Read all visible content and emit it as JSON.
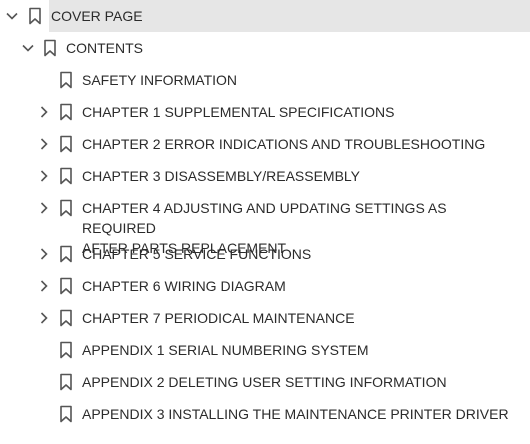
{
  "bookmarks": {
    "cover": {
      "label": "COVER PAGE",
      "expanded": true,
      "selected": true
    },
    "contents": {
      "label": "CONTENTS",
      "expanded": true
    },
    "items": [
      {
        "label": "SAFETY INFORMATION",
        "expandable": false
      },
      {
        "label": "CHAPTER 1 SUPPLEMENTAL SPECIFICATIONS",
        "expandable": true
      },
      {
        "label": "CHAPTER 2 ERROR INDICATIONS AND TROUBLESHOOTING",
        "expandable": true
      },
      {
        "label": "CHAPTER 3 DISASSEMBLY/REASSEMBLY",
        "expandable": true
      },
      {
        "label": "CHAPTER 4 ADJUSTING AND UPDATING SETTINGS AS REQUIRED",
        "label_line2": "AFTER PARTS REPLACEMENT",
        "expandable": true
      },
      {
        "label": "CHAPTER 5 SERVICE FUNCTIONS",
        "expandable": true
      },
      {
        "label": "CHAPTER 6 WIRING DIAGRAM",
        "expandable": true
      },
      {
        "label": "CHAPTER 7 PERIODICAL MAINTENANCE",
        "expandable": true
      },
      {
        "label": "APPENDIX 1 SERIAL NUMBERING SYSTEM",
        "expandable": false
      },
      {
        "label": "APPENDIX 2 DELETING USER SETTING INFORMATION",
        "expandable": false
      },
      {
        "label": "APPENDIX 3 INSTALLING THE MAINTENANCE PRINTER DRIVER",
        "expandable": false
      }
    ]
  },
  "icons": {
    "expand": "chevron-right-icon",
    "collapse": "chevron-down-icon",
    "bookmark": "bookmark-icon"
  },
  "colors": {
    "selection": "#e6e6e6",
    "text": "#2b2b2b",
    "icon": "#555555"
  }
}
